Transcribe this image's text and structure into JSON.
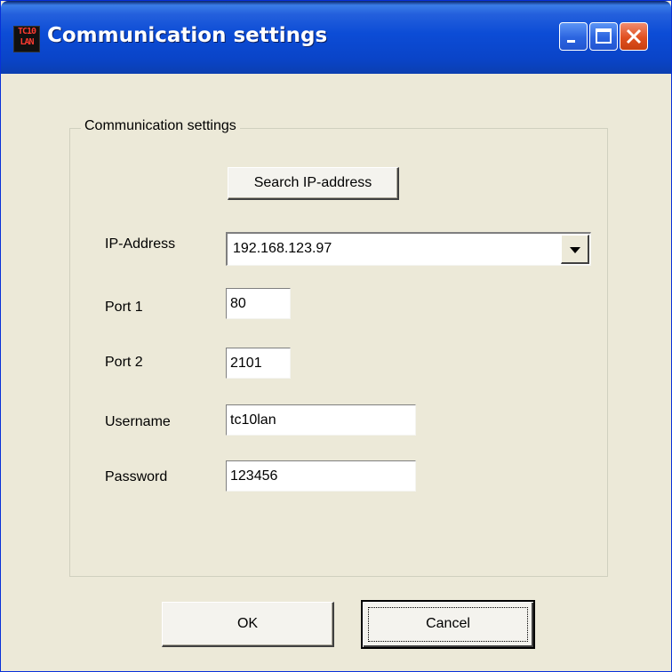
{
  "window": {
    "title": "Communication settings",
    "app_icon_text": [
      "TC10",
      "LAN"
    ]
  },
  "group": {
    "legend": "Communication settings"
  },
  "buttons": {
    "search": "Search IP-address",
    "ok": "OK",
    "cancel": "Cancel"
  },
  "fields": {
    "ip_address": {
      "label": "IP-Address",
      "value": "192.168.123.97"
    },
    "port1": {
      "label": "Port 1",
      "value": "80"
    },
    "port2": {
      "label": "Port 2",
      "value": "2101"
    },
    "username": {
      "label": "Username",
      "value": "tc10lan"
    },
    "password": {
      "label": "Password",
      "value": "123456"
    }
  },
  "icons": {
    "minimize": "minimize-icon",
    "maximize": "maximize-icon",
    "close": "close-icon",
    "dropdown": "chevron-down-icon"
  },
  "colors": {
    "titlebar": "#0A44C8",
    "dialog_bg": "#ECE9D8",
    "close_button": "#E0501F"
  }
}
